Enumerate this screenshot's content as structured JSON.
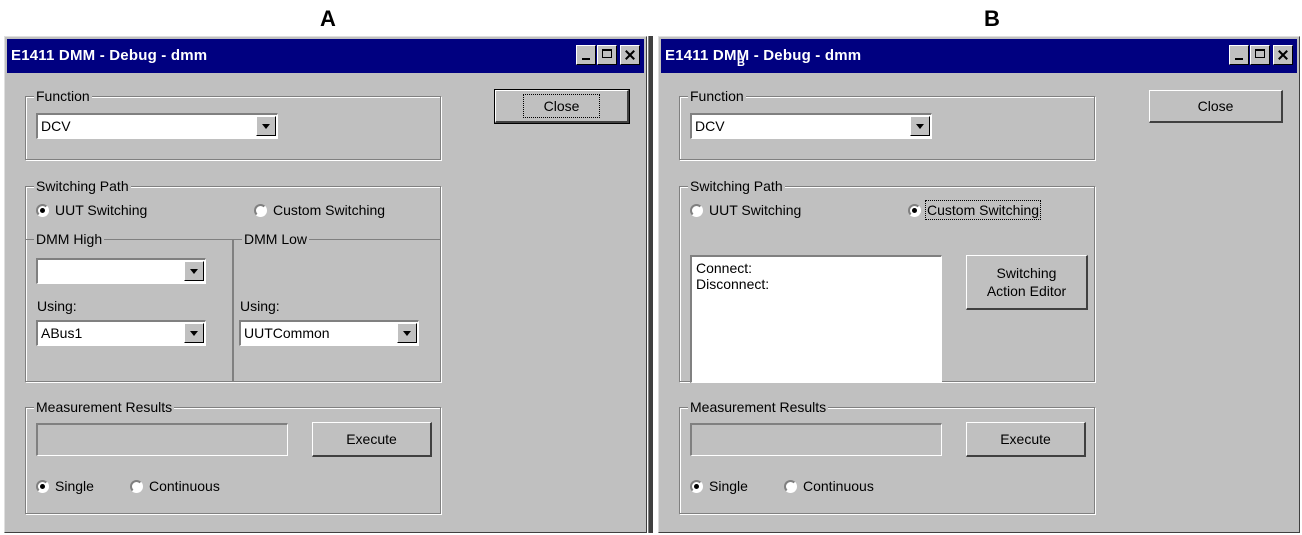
{
  "panel_a": {
    "letter": "A",
    "window_title": "E1411  DMM - Debug - dmm",
    "function": {
      "legend": "Function",
      "value": "DCV"
    },
    "close_label": "Close",
    "switching_path": {
      "legend": "Switching Path",
      "uut_label": "UUT Switching",
      "custom_label": "Custom Switching",
      "selected": "UUT Switching"
    },
    "dmm_high": {
      "legend": "DMM High",
      "value": "",
      "using_label": "Using:",
      "using_value": "ABus1"
    },
    "dmm_low": {
      "legend": "DMM Low",
      "using_label": "Using:",
      "using_value": "UUTCommon"
    },
    "measurement": {
      "legend": "Measurement Results",
      "result": "",
      "execute_label": "Execute",
      "single_label": "Single",
      "continuous_label": "Continuous",
      "selected": "Single"
    }
  },
  "panel_b": {
    "letter": "B",
    "window_title": "E1411  DMM - Debug - dmm",
    "stray_mark": "B",
    "function": {
      "legend": "Function",
      "value": "DCV"
    },
    "close_label": "Close",
    "switching_path": {
      "legend": "Switching Path",
      "uut_label": "UUT Switching",
      "custom_label": "Custom Switching",
      "selected": "Custom Switching"
    },
    "switching_list": {
      "connect": "Connect:",
      "disconnect": "Disconnect:"
    },
    "editor_button": {
      "line1": "Switching",
      "line2": "Action Editor"
    },
    "measurement": {
      "legend": "Measurement Results",
      "result": "",
      "execute_label": "Execute",
      "single_label": "Single",
      "continuous_label": "Continuous",
      "selected": "Single"
    }
  },
  "colors": {
    "titlebar": "#000080",
    "face": "#c0c0c0"
  },
  "icons": [
    "minimize-icon",
    "maximize-icon",
    "close-icon",
    "dropdown-arrow-icon",
    "radio-icon"
  ]
}
